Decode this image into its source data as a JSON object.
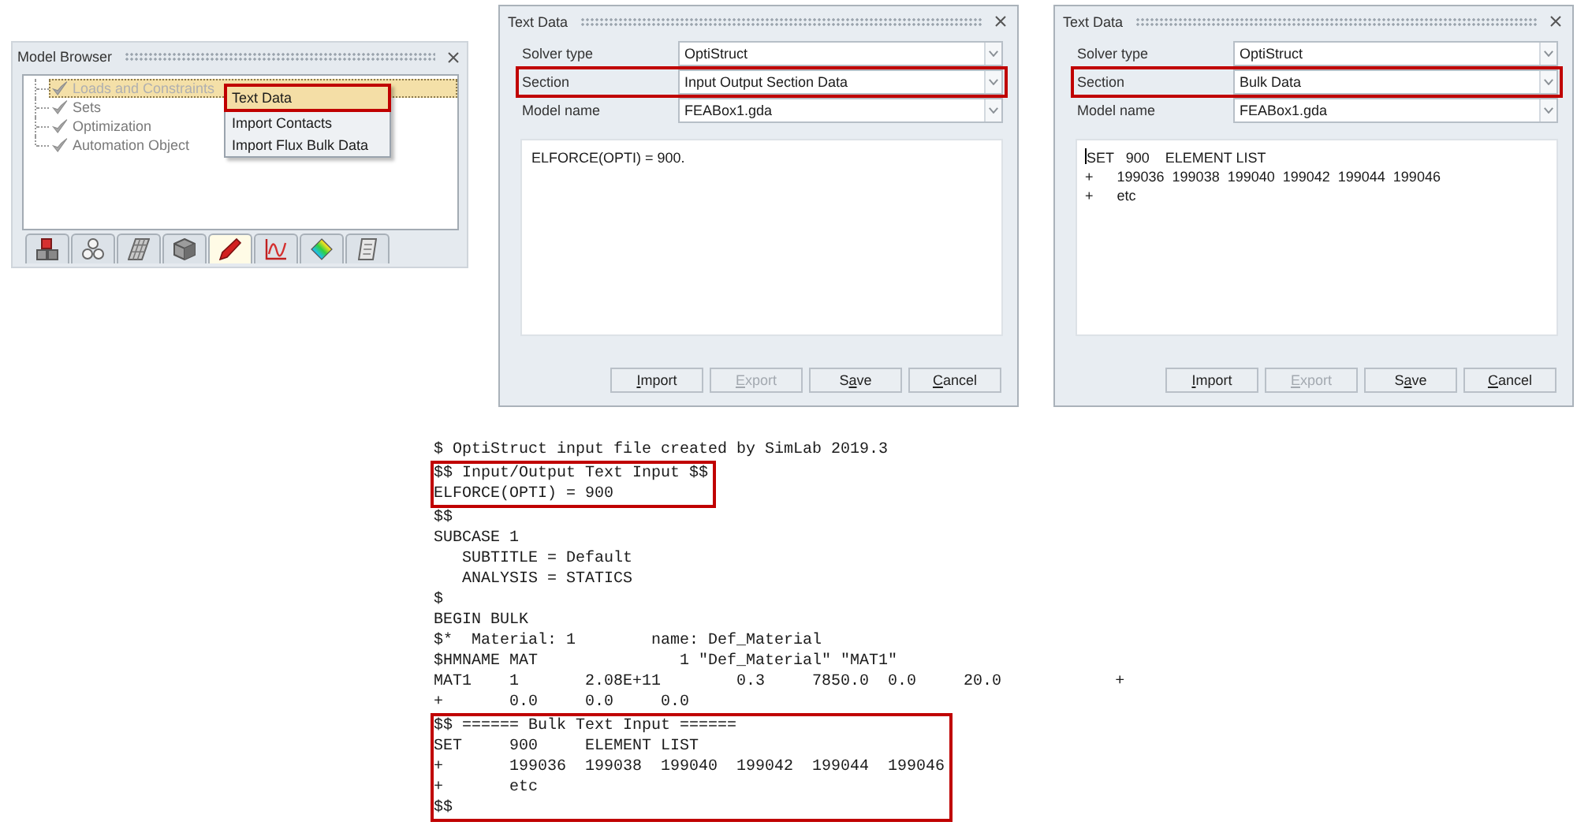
{
  "model_browser": {
    "title": "Model Browser",
    "tree": [
      {
        "label": "Loads and Constraints",
        "selected": true
      },
      {
        "label": "Sets",
        "selected": false
      },
      {
        "label": "Optimization",
        "selected": false
      },
      {
        "label": "Automation Object",
        "selected": false
      }
    ],
    "context_menu": [
      {
        "label": "Text Data",
        "selected": true,
        "highlighted": true
      },
      {
        "label": "Import Contacts",
        "selected": false,
        "highlighted": false
      },
      {
        "label": "Import Flux Bulk Data",
        "selected": false,
        "highlighted": false
      }
    ],
    "tabs": [
      {
        "selected": false
      },
      {
        "selected": false
      },
      {
        "selected": false
      },
      {
        "selected": false
      },
      {
        "selected": true
      },
      {
        "selected": false
      },
      {
        "selected": false
      },
      {
        "selected": false
      }
    ]
  },
  "dialogs": [
    {
      "title": "Text Data",
      "fields": [
        {
          "label": "Solver type",
          "value": "OptiStruct",
          "highlighted": false
        },
        {
          "label": "Section",
          "value": "Input Output Section Data",
          "highlighted": true
        },
        {
          "label": "Model name",
          "value": "FEABox1.gda",
          "highlighted": false
        }
      ],
      "text_area": {
        "lines": [
          "ELFORCE(OPTI) = 900."
        ],
        "focused": false
      },
      "buttons": [
        {
          "label_parts": [
            {
              "text": "I",
              "underlined": true
            },
            {
              "text": "mport",
              "underlined": false
            }
          ],
          "disabled": false
        },
        {
          "label_parts": [
            {
              "text": "E",
              "underlined": true
            },
            {
              "text": "xport",
              "underlined": false
            }
          ],
          "disabled": true
        },
        {
          "label_parts": [
            {
              "text": "S",
              "underlined": false
            },
            {
              "text": "a",
              "underlined": true
            },
            {
              "text": "ve",
              "underlined": false
            }
          ],
          "disabled": false
        },
        {
          "label_parts": [
            {
              "text": "C",
              "underlined": true
            },
            {
              "text": "ancel",
              "underlined": false
            }
          ],
          "disabled": false
        }
      ]
    },
    {
      "title": "Text Data",
      "fields": [
        {
          "label": "Solver type",
          "value": "OptiStruct",
          "highlighted": false
        },
        {
          "label": "Section",
          "value": "Bulk Data",
          "highlighted": true
        },
        {
          "label": "Model name",
          "value": "FEABox1.gda",
          "highlighted": false
        }
      ],
      "text_area": {
        "lines": [
          "SET   900    ELEMENT LIST",
          "+      199036  199038  199040  199042  199044  199046",
          "+      etc"
        ],
        "focused": true
      },
      "buttons": [
        {
          "label_parts": [
            {
              "text": "I",
              "underlined": true
            },
            {
              "text": "mport",
              "underlined": false
            }
          ],
          "disabled": false
        },
        {
          "label_parts": [
            {
              "text": "E",
              "underlined": true
            },
            {
              "text": "xport",
              "underlined": false
            }
          ],
          "disabled": true
        },
        {
          "label_parts": [
            {
              "text": "S",
              "underlined": false
            },
            {
              "text": "a",
              "underlined": true
            },
            {
              "text": "ve",
              "underlined": false
            }
          ],
          "disabled": false
        },
        {
          "label_parts": [
            {
              "text": "C",
              "underlined": true
            },
            {
              "text": "ancel",
              "underlined": false
            }
          ],
          "disabled": false
        }
      ]
    }
  ],
  "file_listing": {
    "blocks": [
      {
        "highlighted": false,
        "lines": [
          "$ OptiStruct input file created by SimLab 2019.3"
        ]
      },
      {
        "highlighted": true,
        "lines": [
          "$$ Input/Output Text Input $$",
          "ELFORCE(OPTI) = 900"
        ]
      },
      {
        "highlighted": false,
        "lines": [
          "$$",
          "SUBCASE 1",
          "   SUBTITLE = Default",
          "   ANALYSIS = STATICS",
          "$",
          "BEGIN BULK",
          "$*  Material: 1        name: Def_Material",
          "$HMNAME MAT               1 \"Def_Material\" \"MAT1\"",
          "MAT1    1       2.08E+11        0.3     7850.0  0.0     20.0            +",
          "+       0.0     0.0     0.0"
        ]
      },
      {
        "highlighted": true,
        "lines": [
          "$$ ====== Bulk Text Input ======",
          "SET     900     ELEMENT LIST",
          "+       199036  199038  199040  199042  199044  199046",
          "+       etc",
          "$$"
        ]
      }
    ]
  }
}
